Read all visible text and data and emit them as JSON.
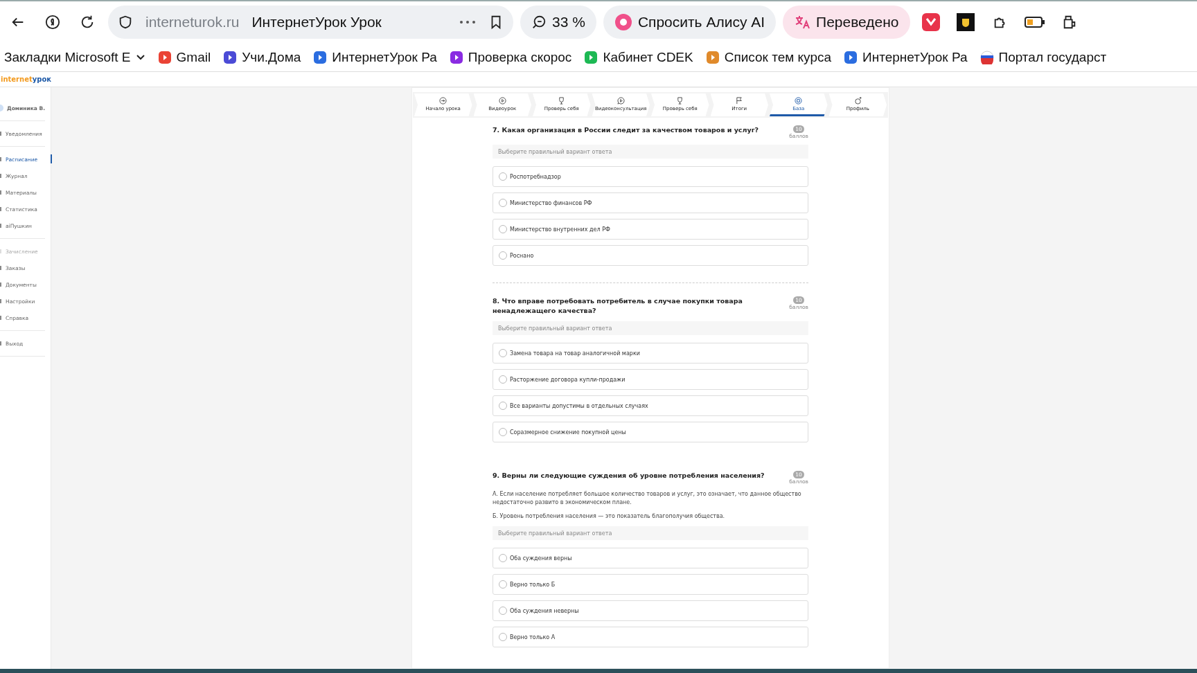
{
  "browser": {
    "address": "interneturok.ru",
    "page_title": "ИнтернетУрок Урок",
    "zoom": "33 %",
    "alice": "Спросить Алису AI",
    "translated": "Переведено"
  },
  "bookmarks": [
    {
      "label": "Закладки Microsoft E",
      "kind": "folder"
    },
    {
      "label": "Gmail",
      "kind": "google"
    },
    {
      "label": "Учи.Дома",
      "kind": "uchi"
    },
    {
      "label": "ИнтернетУрок Ра",
      "kind": "play"
    },
    {
      "label": "Проверка скорос",
      "kind": "speed"
    },
    {
      "label": "Кабинет CDEK",
      "kind": "cdek"
    },
    {
      "label": "Список тем курса",
      "kind": "course"
    },
    {
      "label": "ИнтернетУрок Ра",
      "kind": "play"
    },
    {
      "label": "Портал государст",
      "kind": "flag"
    }
  ],
  "logo": {
    "part_1": "internet",
    "part_2": "урок"
  },
  "sidebar": {
    "user": "Доминика В.",
    "groups": [
      [
        {
          "label": "Уведомления",
          "selected": false,
          "disabled": false
        }
      ],
      [
        {
          "label": "Расписание",
          "selected": true,
          "disabled": false
        },
        {
          "label": "Журнал",
          "selected": false,
          "disabled": false
        },
        {
          "label": "Материалы",
          "selected": false,
          "disabled": false
        },
        {
          "label": "Статистика",
          "selected": false,
          "disabled": false
        },
        {
          "label": "aiПушкин",
          "selected": false,
          "disabled": false
        }
      ],
      [
        {
          "label": "Зачисление",
          "selected": false,
          "disabled": true
        },
        {
          "label": "Заказы",
          "selected": false,
          "disabled": false
        },
        {
          "label": "Документы",
          "selected": false,
          "disabled": false
        },
        {
          "label": "Настройки",
          "selected": false,
          "disabled": false
        },
        {
          "label": "Справка",
          "selected": false,
          "disabled": false
        }
      ],
      [
        {
          "label": "Выход",
          "selected": false,
          "disabled": false
        }
      ]
    ]
  },
  "tabs": [
    {
      "label": "Начало урока",
      "kind": "start",
      "selected": false
    },
    {
      "label": "Видеоурок",
      "kind": "video",
      "selected": false
    },
    {
      "label": "Проверь себя",
      "kind": "test",
      "selected": false
    },
    {
      "label": "Видеоконсультация",
      "kind": "consult",
      "selected": false
    },
    {
      "label": "Проверь себя",
      "kind": "test",
      "selected": false
    },
    {
      "label": "Итоги",
      "kind": "flag",
      "selected": false
    },
    {
      "label": "База",
      "kind": "base",
      "selected": true
    },
    {
      "label": "Профиль",
      "kind": "profile",
      "selected": false
    }
  ],
  "questions": [
    {
      "title": "7. Какая организация в России следит за качеством товаров и услуг?",
      "points": "10",
      "points_label": "баллов",
      "hint": "Выберите правильный вариант ответа",
      "options": [
        {
          "label": "Роспотребнадзор",
          "selected": false
        },
        {
          "label": "Министерство финансов РФ",
          "selected": false
        },
        {
          "label": "Министерство внутренних дел РФ",
          "selected": false
        },
        {
          "label": "Роснано",
          "selected": false
        }
      ],
      "divider": true
    },
    {
      "title": "8. Что вправе потребовать потребитель в случае покупки товара ненадлежащего качества?",
      "points": "10",
      "points_label": "баллов",
      "hint": "Выберите правильный вариант ответа",
      "options": [
        {
          "label": "Замена товара на товар аналогичной марки",
          "selected": false
        },
        {
          "label": "Расторжение договора купли-продажи",
          "selected": false
        },
        {
          "label": "Все варианты допустимы в отдельных случаях",
          "selected": false
        },
        {
          "label": "Соразмерное снижение покупной цены",
          "selected": false
        }
      ],
      "divider": false
    },
    {
      "title": "9. Верны ли следующие суждения об уровне потребления населения?",
      "points": "10",
      "points_label": "баллов",
      "statements": [
        "А. Если население потребляет большое количество товаров и услуг, это означает, что данное общество недостаточно развито в экономическом плане.",
        "Б. Уровень потребления населения — это показатель благополучия общества."
      ],
      "hint": "Выберите правильный вариант ответа",
      "options": [
        {
          "label": "Оба суждения верны",
          "selected": false
        },
        {
          "label": "Верно только Б",
          "selected": false
        },
        {
          "label": "Оба суждения неверны",
          "selected": false
        },
        {
          "label": "Верно только А",
          "selected": false
        }
      ],
      "divider": false
    }
  ]
}
